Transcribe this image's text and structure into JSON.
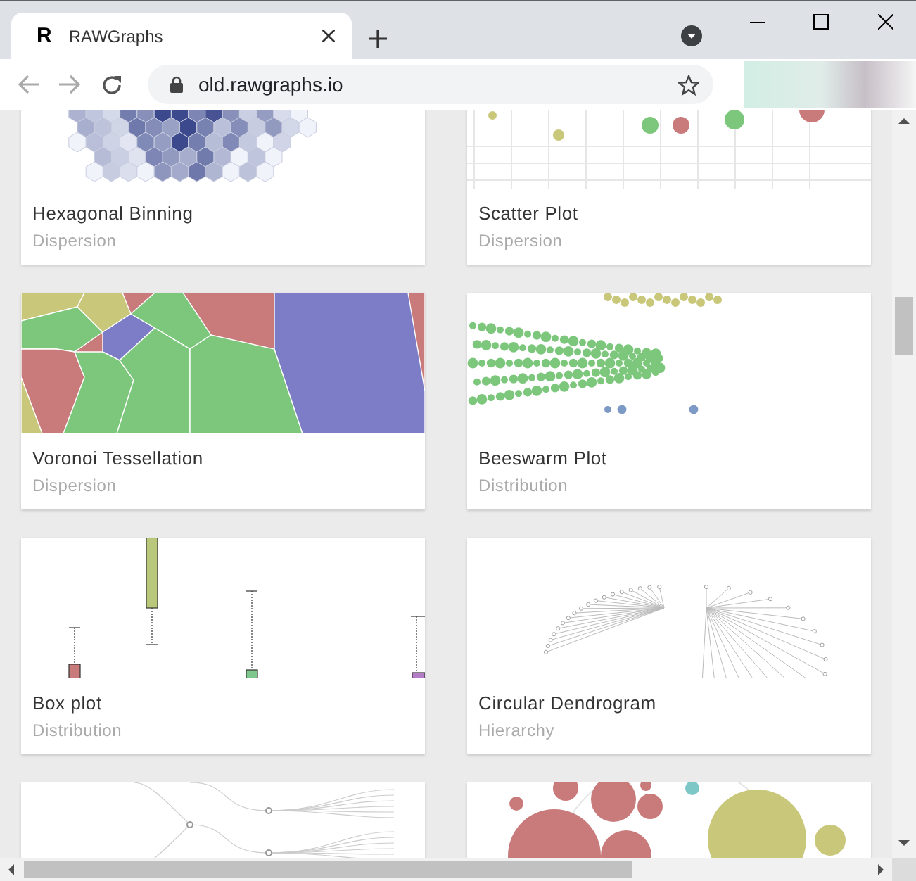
{
  "browser": {
    "tab": {
      "favicon": "R",
      "title": "RAWGraphs",
      "selected": true
    },
    "address": "old.rawgraphs.io"
  },
  "cards": [
    {
      "kind": "hexbin",
      "title": "Hexagonal Binning",
      "category": "Dispersion"
    },
    {
      "kind": "scatter",
      "title": "Scatter Plot",
      "category": "Dispersion"
    },
    {
      "kind": "voronoi",
      "title": "Voronoi Tessellation",
      "category": "Dispersion"
    },
    {
      "kind": "beeswarm",
      "title": "Beeswarm Plot",
      "category": "Distribution"
    },
    {
      "kind": "boxplot",
      "title": "Box plot",
      "category": "Distribution"
    },
    {
      "kind": "dendrogram",
      "title": "Circular Dendrogram",
      "category": "Hierarchy"
    },
    {
      "kind": "tree"
    },
    {
      "kind": "bubbles"
    }
  ]
}
